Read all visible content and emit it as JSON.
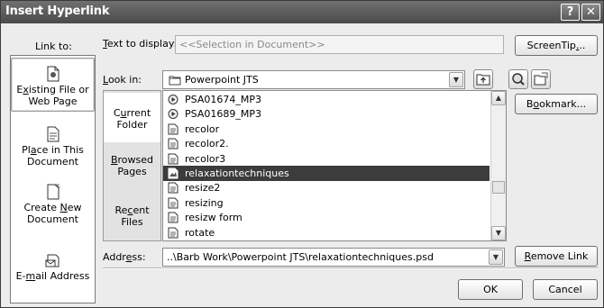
{
  "window": {
    "title": "Insert Hyperlink",
    "help_glyph": "?",
    "close_glyph": "✕"
  },
  "labels": {
    "link_to": "Link to:",
    "text_to_display": "Text to display:",
    "look_in": "Look in:",
    "address": "Address:"
  },
  "text_to_display": {
    "value": "<<Selection in Document>>"
  },
  "look_in": {
    "value": "Powerpoint JTS"
  },
  "address": {
    "value": "..\\Barb Work\\Powerpoint JTS\\relaxationtechniques.psd"
  },
  "link_to_items": [
    {
      "label1": "Existing File or",
      "label2": "Web Page",
      "icon": "existing-file-icon",
      "selected": true
    },
    {
      "label1": "Place in This",
      "label2": "Document",
      "icon": "place-in-document-icon",
      "selected": false
    },
    {
      "label1": "Create New",
      "label2": "Document",
      "icon": "new-document-icon",
      "selected": false
    },
    {
      "label1": "E-mail Address",
      "label2": "",
      "icon": "email-icon",
      "selected": false
    }
  ],
  "folder_tabs": [
    {
      "label1": "Current",
      "label2": "Folder",
      "active": true
    },
    {
      "label1": "Browsed",
      "label2": "Pages",
      "active": false
    },
    {
      "label1": "Recent",
      "label2": "Files",
      "active": false
    }
  ],
  "files": [
    {
      "name": "PSA01674_MP3",
      "icon": "audio-file-icon",
      "selected": false
    },
    {
      "name": "PSA01689_MP3",
      "icon": "audio-file-icon",
      "selected": false
    },
    {
      "name": "recolor",
      "icon": "document-file-icon",
      "selected": false
    },
    {
      "name": "recolor2.",
      "icon": "document-file-icon",
      "selected": false
    },
    {
      "name": "recolor3",
      "icon": "document-file-icon",
      "selected": false
    },
    {
      "name": "relaxationtechniques",
      "icon": "image-file-icon",
      "selected": true
    },
    {
      "name": "resize2",
      "icon": "document-file-icon",
      "selected": false
    },
    {
      "name": "resizing",
      "icon": "document-file-icon",
      "selected": false
    },
    {
      "name": "resizw form",
      "icon": "document-file-icon",
      "selected": false
    },
    {
      "name": "rotate",
      "icon": "document-file-icon",
      "selected": false
    }
  ],
  "buttons": {
    "screentip": "ScreenTip...",
    "bookmark": "Bookmark...",
    "remove_link": "Remove Link",
    "ok": "OK",
    "cancel": "Cancel"
  },
  "colors": {
    "titlebar": "#5a5a5a",
    "selection": "#3c3c3c",
    "dialog_bg": "#ececec"
  }
}
